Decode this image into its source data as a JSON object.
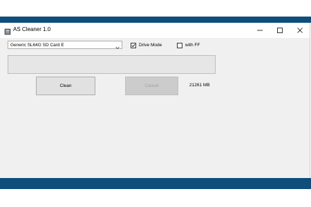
{
  "window": {
    "title": "AS Cleaner 1.0",
    "controls": [
      "minimize-icon",
      "maximize-icon",
      "close-icon"
    ]
  },
  "drive_select": {
    "selected": "Generic SL64G SD Card E"
  },
  "checkboxes": {
    "drive_mode": {
      "label": "Drive Mode",
      "checked": true
    },
    "with_ff": {
      "label": "with FF",
      "checked": false
    }
  },
  "progress": {
    "value": 0
  },
  "buttons": {
    "clean": "Clean",
    "cancel": "Cancel"
  },
  "status": {
    "size": "21261 MB"
  },
  "colors": {
    "desktop_blue": "#0f4d7a",
    "window_bg": "#f0f0f0"
  }
}
